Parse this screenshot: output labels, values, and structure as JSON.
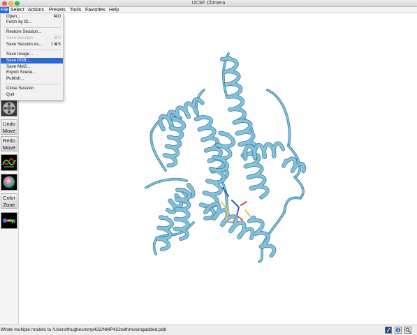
{
  "window": {
    "title": "UCSF Chimera"
  },
  "menubar": {
    "items": [
      {
        "label": "File",
        "active": true
      },
      {
        "label": "Select"
      },
      {
        "label": "Actions"
      },
      {
        "label": "Presets"
      },
      {
        "label": "Tools"
      },
      {
        "label": "Favorites"
      },
      {
        "label": "Help"
      }
    ]
  },
  "file_menu": {
    "items": [
      {
        "label": "Open...",
        "shortcut": "⌘O"
      },
      {
        "label": "Fetch by ID..."
      },
      {
        "label": "Restore Session..."
      },
      {
        "label": "Save Session",
        "shortcut": "⌘S",
        "disabled": true
      },
      {
        "label": "Save Session As...",
        "shortcut": "⇧⌘S"
      },
      {
        "label": "Save Image..."
      },
      {
        "label": "Save PDB...",
        "selected": true
      },
      {
        "label": "Save Mol2..."
      },
      {
        "label": "Export Scene..."
      },
      {
        "label": "Publish..."
      },
      {
        "label": "Close Session"
      },
      {
        "label": "Quit"
      }
    ]
  },
  "toolbar": {
    "undo_move": [
      "Undo",
      "Move"
    ],
    "redo_move": [
      "Redo",
      "Move"
    ],
    "color_zone": [
      "Color",
      "Zone"
    ]
  },
  "status": {
    "message": "Wrote multiple models to /Users/thughes/nmp422/NMP422withmissingadded.pdb"
  },
  "colors": {
    "ribbon": "#83c1dc",
    "ribbon_dark": "#3f7d98",
    "menu_highlight": "#2e6bd1"
  }
}
